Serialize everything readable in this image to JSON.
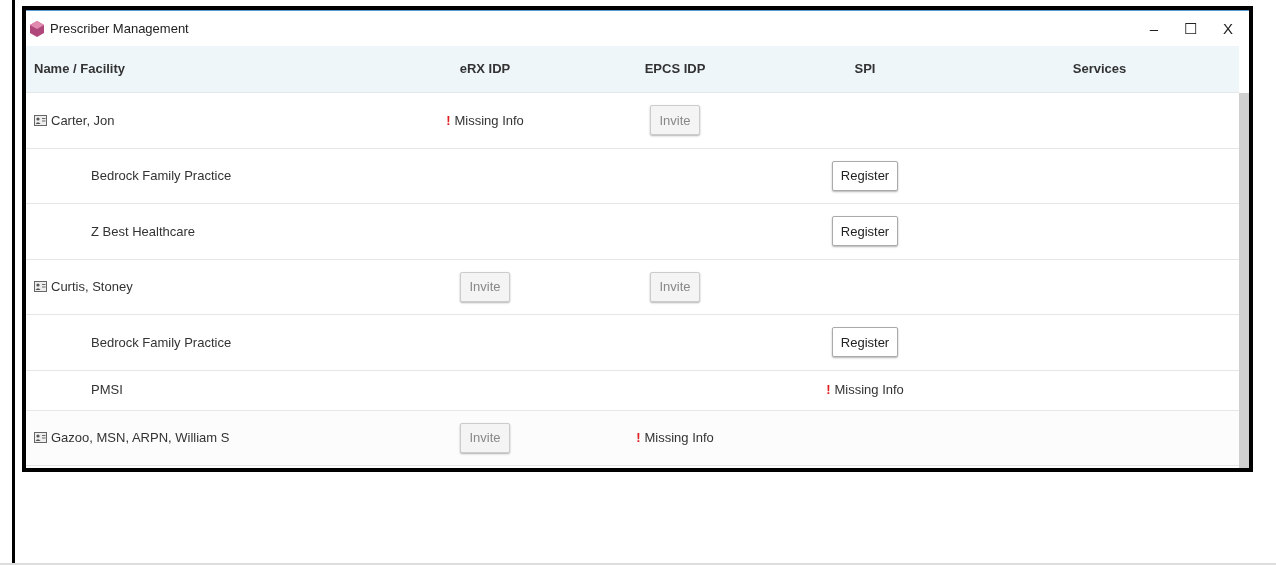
{
  "window": {
    "title": "Prescriber Management",
    "controls": [
      "–",
      "☐",
      "X"
    ]
  },
  "table": {
    "columns": [
      "Name / Facility",
      "eRX IDP",
      "EPCS IDP",
      "SPI",
      "Services"
    ],
    "rows": [
      {
        "kind": "prescriber",
        "cells": [
          {
            "kind": "name",
            "text": "Carter, Jon"
          },
          {
            "kind": "missing",
            "mark": "!",
            "text": "Missing Info"
          },
          {
            "kind": "button",
            "text": "Invite",
            "disabled": true
          },
          null,
          null
        ]
      },
      {
        "kind": "facility",
        "cells": [
          {
            "kind": "name",
            "text": "Bedrock Family Practice"
          },
          null,
          null,
          {
            "kind": "button",
            "text": "Register",
            "disabled": false
          },
          null
        ]
      },
      {
        "kind": "facility",
        "cells": [
          {
            "kind": "name",
            "text": "Z Best Healthcare"
          },
          null,
          null,
          {
            "kind": "button",
            "text": "Register",
            "disabled": false
          },
          null
        ]
      },
      {
        "kind": "prescriber",
        "cells": [
          {
            "kind": "name",
            "text": "Curtis, Stoney"
          },
          {
            "kind": "button",
            "text": "Invite",
            "disabled": true
          },
          {
            "kind": "button",
            "text": "Invite",
            "disabled": true
          },
          null,
          null
        ]
      },
      {
        "kind": "facility",
        "cells": [
          {
            "kind": "name",
            "text": "Bedrock Family Practice"
          },
          null,
          null,
          {
            "kind": "button",
            "text": "Register",
            "disabled": false
          },
          null
        ]
      },
      {
        "kind": "facility",
        "cells": [
          {
            "kind": "name",
            "text": "PMSI"
          },
          null,
          null,
          {
            "kind": "missing",
            "mark": "!",
            "text": "Missing Info"
          },
          null
        ]
      },
      {
        "kind": "prescriber",
        "cells": [
          {
            "kind": "name",
            "text": "Gazoo, MSN, ARPN, William S"
          },
          {
            "kind": "button",
            "text": "Invite",
            "disabled": true
          },
          {
            "kind": "missing",
            "mark": "!",
            "text": "Missing Info"
          },
          null,
          null
        ]
      }
    ]
  }
}
